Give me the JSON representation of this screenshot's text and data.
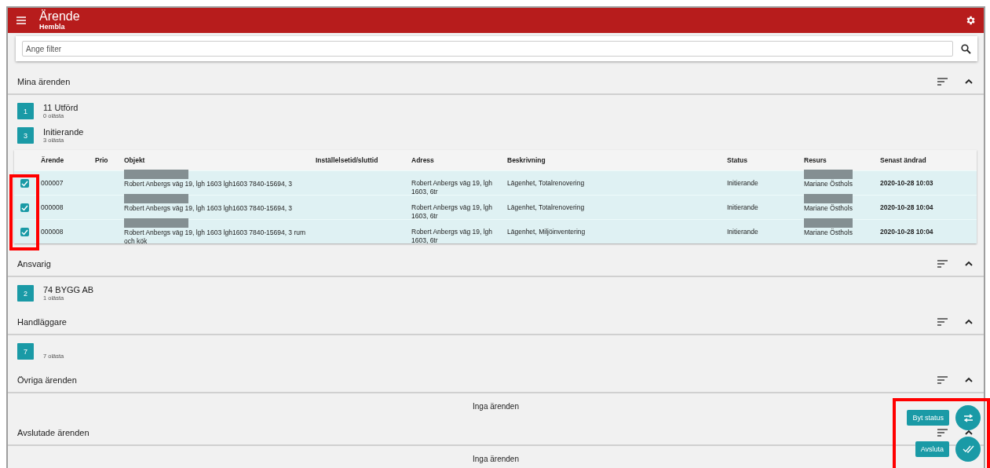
{
  "header": {
    "title": "Ärende",
    "subtitle": "Hembla"
  },
  "filter": {
    "placeholder": "Ange filter"
  },
  "sections": [
    {
      "title": "Mina ärenden",
      "groups": [
        {
          "badge": "1",
          "name": "11 Utförd",
          "unread": "0 olästa"
        },
        {
          "badge": "3",
          "name": "Initierande",
          "unread": "3 olästa",
          "table": {
            "columns": [
              "Ärende",
              "Prio",
              "Objekt",
              "Inställelsetid/sluttid",
              "Adress",
              "Beskrivning",
              "Status",
              "Resurs",
              "Senast ändrad"
            ],
            "rows": [
              {
                "checked": true,
                "cells": [
                  "000007",
                  "",
                  "Robert Anbergs väg 19, lgh 1603 lgh1603 7840-15694, 3",
                  "",
                  "Robert Anbergs väg 19, lgh 1603, 6tr",
                  "Lägenhet, Totalrenovering",
                  "Initierande",
                  "Mariane Östhols",
                  "2020-10-28 10:03"
                ]
              },
              {
                "checked": true,
                "cells": [
                  "000008",
                  "",
                  "Robert Anbergs väg 19, lgh 1603 lgh1603 7840-15694, 3",
                  "",
                  "Robert Anbergs väg 19, lgh 1603, 6tr",
                  "Lägenhet, Totalrenovering",
                  "Initierande",
                  "Mariane Östhols",
                  "2020-10-28 10:04"
                ]
              },
              {
                "checked": true,
                "cells": [
                  "000008",
                  "",
                  "Robert Anbergs väg 19, lgh 1603 lgh1603 7840-15694, 3 rum och kök",
                  "",
                  "Robert Anbergs väg 19, lgh 1603, 6tr",
                  "Lägenhet, Miljöinventering",
                  "Initierande",
                  "Mariane Östhols",
                  "2020-10-28 10:04"
                ]
              }
            ]
          }
        }
      ]
    },
    {
      "title": "Ansvarig",
      "groups": [
        {
          "badge": "2",
          "name": "74 BYGG AB",
          "unread": "1 olästa"
        }
      ]
    },
    {
      "title": "Handläggare",
      "groups": [
        {
          "badge": "7",
          "unread": "7 olästa"
        }
      ]
    },
    {
      "title": "Övriga ärenden",
      "empty_text": "Inga ärenden"
    },
    {
      "title": "Avslutade ärenden",
      "empty_text": "Inga ärenden"
    }
  ],
  "fab_actions": [
    {
      "kind": "swap",
      "label": "Byt status"
    },
    {
      "kind": "done",
      "label": "Avsluta"
    }
  ]
}
